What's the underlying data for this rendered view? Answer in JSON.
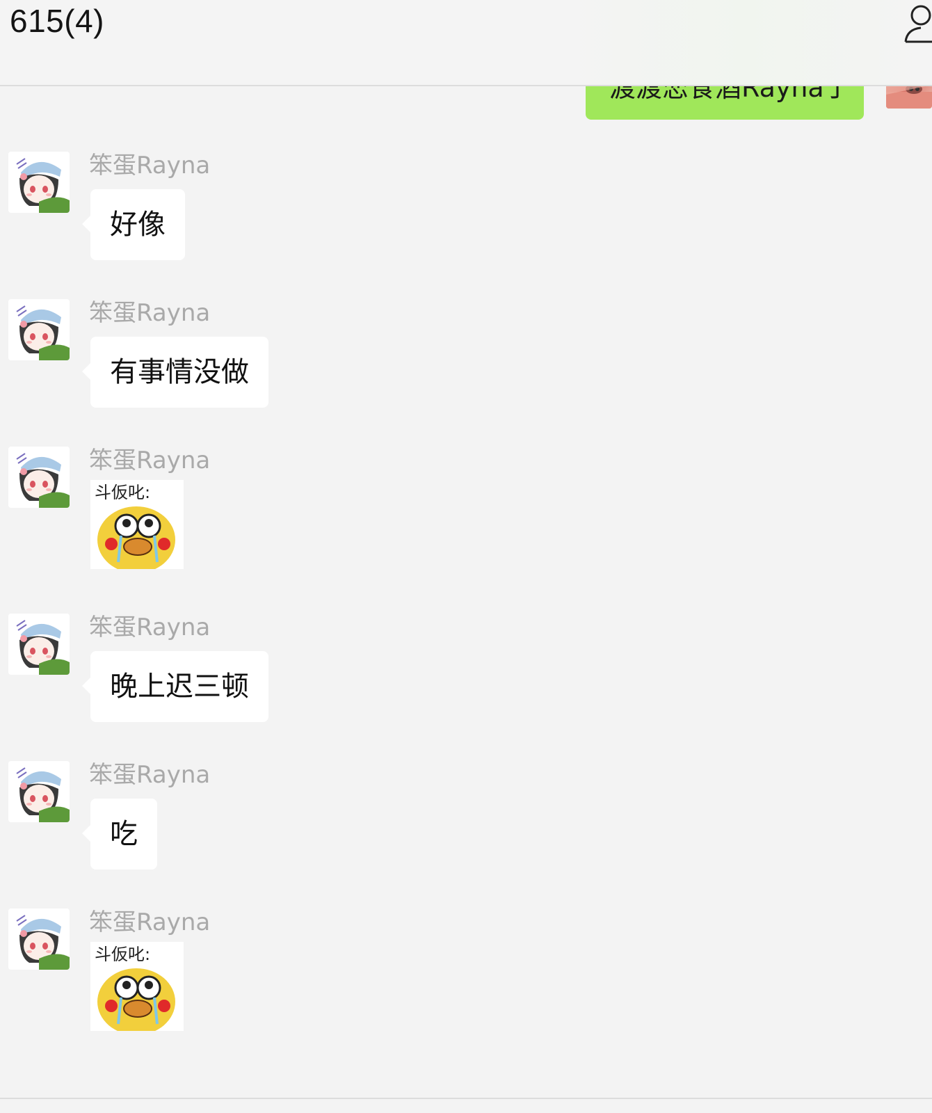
{
  "header": {
    "title": "615(4)",
    "members_icon": "person-icon"
  },
  "outgoing": {
    "text": "渡渡恋食酒Rayna亅"
  },
  "messages": [
    {
      "sender": "笨蛋Rayna",
      "type": "text",
      "text": "好像"
    },
    {
      "sender": "笨蛋Rayna",
      "type": "text",
      "text": "有事情没做"
    },
    {
      "sender": "笨蛋Rayna",
      "type": "sticker",
      "sticker_caption": "斗仮叱:",
      "sticker": "crying-duck-sticker"
    },
    {
      "sender": "笨蛋Rayna",
      "type": "text",
      "text": "晚上迟三顿"
    },
    {
      "sender": "笨蛋Rayna",
      "type": "text",
      "text": "吃"
    },
    {
      "sender": "笨蛋Rayna",
      "type": "sticker",
      "sticker_caption": "斗仮叱:",
      "sticker": "crying-duck-sticker"
    }
  ],
  "colors": {
    "background": "#f3f3f3",
    "outgoing_bubble": "#a0e75a",
    "incoming_bubble": "#ffffff",
    "sender_name": "#a9a9a9"
  }
}
